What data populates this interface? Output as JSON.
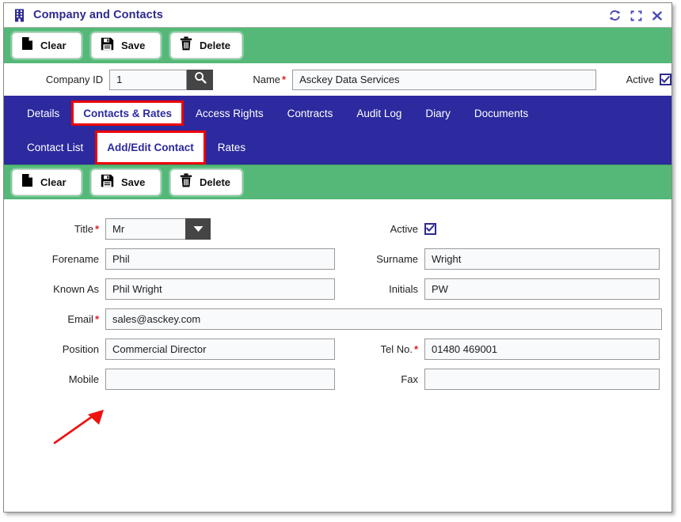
{
  "window": {
    "title": "Company and Contacts",
    "title_icon": "building-icon",
    "controls": [
      {
        "name": "refresh-icon",
        "label": "Refresh"
      },
      {
        "name": "maximize-icon",
        "label": "Maximize"
      },
      {
        "name": "close-icon",
        "label": "Close"
      }
    ]
  },
  "colors": {
    "toolbar_green": "#55b878",
    "tabbar_navy": "#2c2a9e",
    "title_text": "#2e2a8f",
    "required_red": "#e02020",
    "highlight_red": "#ee0000",
    "input_bg": "#f8fafc",
    "dark_button": "#454545"
  },
  "toolbar_top": {
    "buttons": [
      {
        "name": "clear-button",
        "label": "Clear",
        "icon": "document-icon"
      },
      {
        "name": "save-button",
        "label": "Save",
        "icon": "floppy-disk-icon"
      },
      {
        "name": "delete-button",
        "label": "Delete",
        "icon": "trash-icon"
      }
    ]
  },
  "company_bar": {
    "company_id_label": "Company ID",
    "company_id_value": "1",
    "company_id_placeholder": "",
    "search_icon": "search-icon",
    "name_label": "Name",
    "name_required": "*",
    "name_value": "Asckey Data Services",
    "name_placeholder": "",
    "active_label": "Active",
    "active_checked": true
  },
  "tabs_primary": [
    {
      "label": "Details",
      "active": false
    },
    {
      "label": "Contacts & Rates",
      "active": true
    },
    {
      "label": "Access Rights",
      "active": false
    },
    {
      "label": "Contracts",
      "active": false
    },
    {
      "label": "Audit Log",
      "active": false
    },
    {
      "label": "Diary",
      "active": false
    },
    {
      "label": "Documents",
      "active": false
    }
  ],
  "tabs_secondary": [
    {
      "label": "Contact List",
      "active": false
    },
    {
      "label": "Add/Edit Contact",
      "active": true
    },
    {
      "label": "Rates",
      "active": false
    }
  ],
  "toolbar_contact": {
    "buttons": [
      {
        "name": "clear-button",
        "label": "Clear",
        "icon": "document-icon"
      },
      {
        "name": "save-button",
        "label": "Save",
        "icon": "floppy-disk-icon"
      },
      {
        "name": "delete-button",
        "label": "Delete",
        "icon": "trash-icon"
      }
    ]
  },
  "contact_form": {
    "title_label": "Title",
    "title_required": "*",
    "title_value": "Mr",
    "active_label": "Active",
    "active_checked": true,
    "forename_label": "Forename",
    "forename_value": "Phil",
    "surname_label": "Surname",
    "surname_value": "Wright",
    "known_as_label": "Known As",
    "known_as_value": "Phil Wright",
    "initials_label": "Initials",
    "initials_value": "PW",
    "email_label": "Email",
    "email_required": "*",
    "email_value": "sales@asckey.com",
    "position_label": "Position",
    "position_value": "Commercial Director",
    "tel_label": "Tel No.",
    "tel_required": "*",
    "tel_value": "01480 469001",
    "mobile_label": "Mobile",
    "mobile_value": "",
    "fax_label": "Fax",
    "fax_value": ""
  },
  "annotation": {
    "arrow_target": "save-button",
    "arrow_color": "#ee1111"
  }
}
